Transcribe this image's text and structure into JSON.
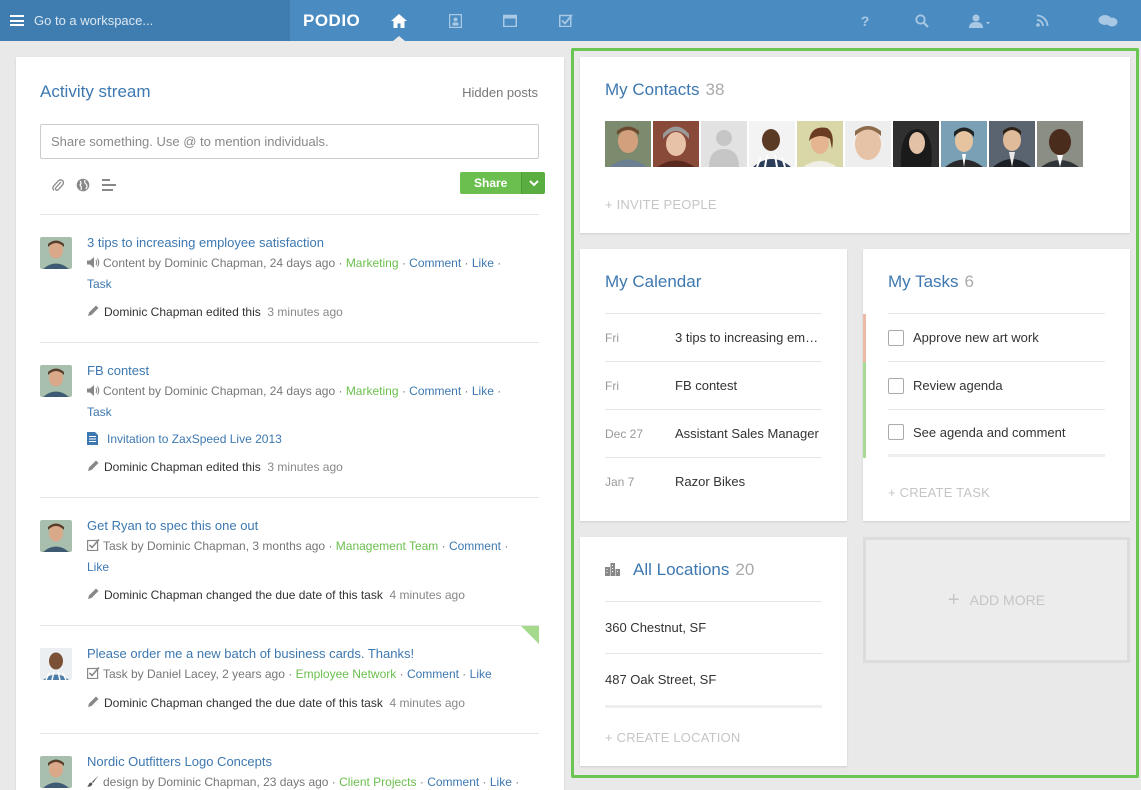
{
  "topbar": {
    "workspace_label": "Go to a workspace...",
    "logo": "PODIO",
    "nav_icons": [
      "home-icon",
      "contacts-icon",
      "calendar-icon",
      "tasks-icon"
    ],
    "right_icons": [
      "help-icon",
      "search-icon",
      "user-menu-icon",
      "feed-icon",
      "chat-icon"
    ]
  },
  "activity": {
    "title": "Activity stream",
    "hidden_posts": "Hidden posts",
    "share_placeholder": "Share something. Use @ to mention individuals.",
    "share_button": "Share",
    "posts": [
      {
        "title": "3 tips to increasing employee satisfaction",
        "meta_text": "Content by Dominic Chapman, 24 days ago ·",
        "tag": "Marketing",
        "actions": [
          "Comment",
          "Like",
          "Task"
        ],
        "edit_user": "Dominic Chapman edited this",
        "edit_time": "3 minutes ago"
      },
      {
        "title": "FB contest",
        "meta_text": "Content by Dominic Chapman, 24 days ago ·",
        "tag": "Marketing",
        "actions": [
          "Comment",
          "Like",
          "Task"
        ],
        "attachment": "Invitation to ZaxSpeed Live 2013",
        "edit_user": "Dominic Chapman edited this",
        "edit_time": "3 minutes ago"
      },
      {
        "title": "Get Ryan to spec this one out",
        "meta_text": "Task by Dominic Chapman, 3 months ago ·",
        "tag": "Management Team",
        "actions": [
          "Comment",
          "Like"
        ],
        "edit_user": "Dominic Chapman changed the due date of this task",
        "edit_time": "4 minutes ago"
      },
      {
        "title": "Please order me a new batch of business cards. Thanks!",
        "meta_text": "Task by Daniel Lacey, 2 years ago ·",
        "tag": "Employee Network",
        "actions": [
          "Comment",
          "Like"
        ],
        "edit_user": "Dominic Chapman changed the due date of this task",
        "edit_time": "4 minutes ago"
      },
      {
        "title": "Nordic Outfitters Logo Concepts",
        "meta_text": "design by Dominic Chapman, 23 days ago ·",
        "tag": "Client Projects",
        "actions": [
          "Comment",
          "Like"
        ]
      }
    ]
  },
  "contacts": {
    "title": "My Contacts",
    "count": "38",
    "invite": "+ INVITE PEOPLE"
  },
  "calendar": {
    "title": "My Calendar",
    "events": [
      {
        "date": "Fri",
        "title": "3 tips to increasing em…"
      },
      {
        "date": "Fri",
        "title": "FB contest"
      },
      {
        "date": "Dec 27",
        "title": "Assistant Sales Manager"
      },
      {
        "date": "Jan 7",
        "title": "Razor Bikes"
      }
    ]
  },
  "tasks": {
    "title": "My Tasks",
    "count": "6",
    "items": [
      {
        "label": "Approve new art work",
        "color": "#f0b8a8"
      },
      {
        "label": "Review agenda",
        "color": "#a9d996"
      },
      {
        "label": "See agenda and comment",
        "color": "#a9d996"
      }
    ],
    "create": "+ CREATE TASK"
  },
  "locations": {
    "title": "All Locations",
    "count": "20",
    "items": [
      "360 Chestnut, SF",
      "487 Oak Street, SF"
    ],
    "create": "+ CREATE LOCATION"
  },
  "add_more": "ADD MORE",
  "colors": {
    "topbar": "#4a8bc1",
    "accent_green": "#6bbf4e",
    "link_blue": "#3d78b0",
    "frame_green": "#6bc552"
  }
}
